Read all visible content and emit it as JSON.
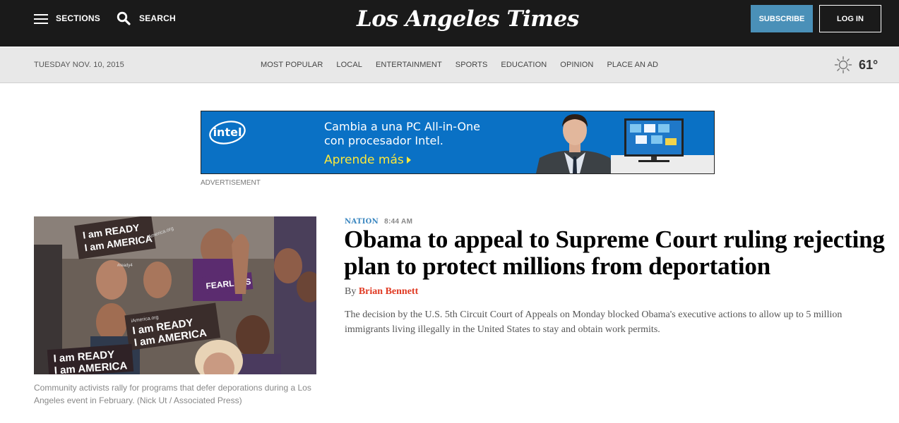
{
  "header": {
    "sections_label": "SECTIONS",
    "search_label": "SEARCH",
    "logo_text": "Los Angeles Times",
    "subscribe_label": "SUBSCRIBE",
    "login_label": "LOG IN",
    "bar_color": "#1a1a1a",
    "subscribe_color": "#4a90b8"
  },
  "subnav": {
    "date": "TUESDAY NOV. 10, 2015",
    "items": [
      "MOST POPULAR",
      "LOCAL",
      "ENTERTAINMENT",
      "SPORTS",
      "EDUCATION",
      "OPINION",
      "PLACE AN AD"
    ],
    "temperature": "61°",
    "weather_icon": "sun-icon"
  },
  "ad": {
    "brand": "intel",
    "line1": "Cambia a una PC All-in-One",
    "line2": "con procesador Intel.",
    "cta": "Aprende más",
    "label": "ADVERTISEMENT",
    "background": "#0a71c5",
    "cta_color": "#fce83a"
  },
  "story": {
    "photo_signs": [
      "I am READY",
      "I am AMERICA",
      "FEARLESS",
      "iAmerica.org",
      "#ready4"
    ],
    "caption": "Community activists rally for programs that defer deporations during a Los Angeles event in February. (Nick Ut / Associated Press)",
    "section": "NATION",
    "time": "8:44 AM",
    "headline": "Obama to appeal to Supreme Court ruling rejecting plan to protect millions from deportation",
    "by": "By",
    "author": "Brian Bennett",
    "summary": "The decision by the U.S. 5th Circuit Court of Appeals on Monday blocked Obama's executive actions to allow up to 5 million immigrants living illegally in the United States to stay and obtain work permits.",
    "author_color": "#e03a23",
    "section_color": "#3b87c0"
  }
}
